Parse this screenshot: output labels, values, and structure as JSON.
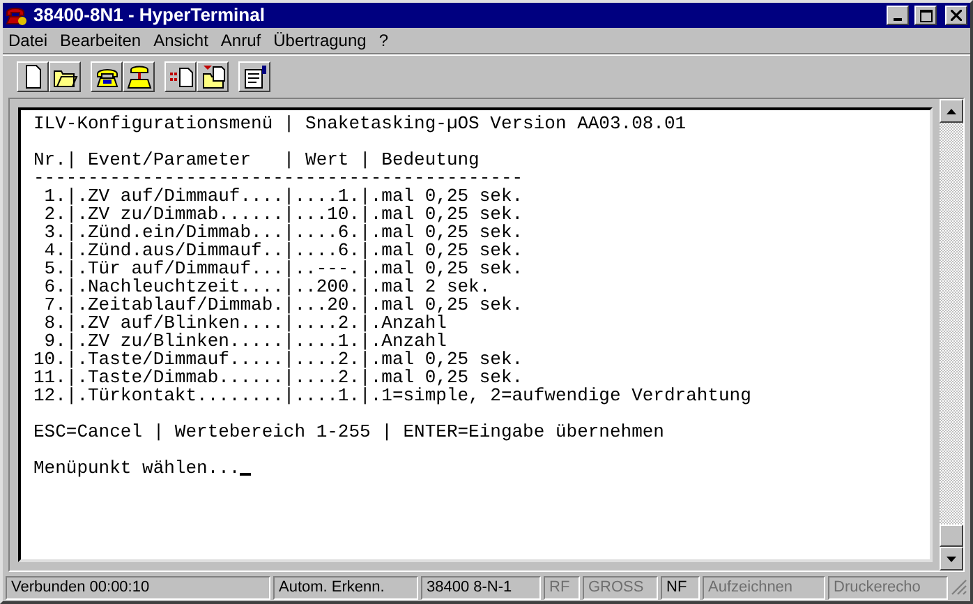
{
  "window": {
    "title": "38400-8N1 - HyperTerminal"
  },
  "menu": [
    "Datei",
    "Bearbeiten",
    "Ansicht",
    "Anruf",
    "Übertragung",
    "?"
  ],
  "toolbar": [
    {
      "kind": "new"
    },
    {
      "kind": "open"
    },
    {
      "kind": "call"
    },
    {
      "kind": "hangup"
    },
    {
      "kind": "send"
    },
    {
      "kind": "receive"
    },
    {
      "kind": "properties"
    }
  ],
  "terminal": {
    "blocks": [
      {
        "lines": [
          "ILV-Konfigurationsmenü | Snaketasking-µOS Version AA03.08.01"
        ]
      },
      {
        "lines": [
          "Nr.| Event/Parameter   | Wert | Bedeutung",
          "---------------------------------------------",
          " 1.|.ZV auf/Dimmauf....|....1.|.mal 0,25 sek.",
          " 2.|.ZV zu/Dimmab......|...10.|.mal 0,25 sek.",
          " 3.|.Zünd.ein/Dimmab...|....6.|.mal 0,25 sek.",
          " 4.|.Zünd.aus/Dimmauf..|....6.|.mal 0,25 sek.",
          " 5.|.Tür auf/Dimmauf...|..---.|.mal 0,25 sek.",
          " 6.|.Nachleuchtzeit....|..200.|.mal 2 sek.",
          " 7.|.Zeitablauf/Dimmab.|...20.|.mal 0,25 sek.",
          " 8.|.ZV auf/Blinken....|....2.|.Anzahl",
          " 9.|.ZV zu/Blinken.....|....1.|.Anzahl",
          "10.|.Taste/Dimmauf.....|....2.|.mal 0,25 sek.",
          "11.|.Taste/Dimmab......|....2.|.mal 0,25 sek.",
          "12.|.Türkontakt........|....1.|.1=simple, 2=aufwendige Verdrahtung"
        ]
      },
      {
        "lines": [
          "ESC=Cancel | Wertebereich 1-255 | ENTER=Eingabe übernehmen"
        ]
      }
    ],
    "prompt": "Menüpunkt wählen...",
    "cursor": true
  },
  "status_bar": [
    {
      "text": "Verbunden 00:00:10",
      "disabled": false
    },
    {
      "text": "Autom. Erkenn.",
      "disabled": false
    },
    {
      "text": "38400 8-N-1",
      "disabled": false
    },
    {
      "text": "RF",
      "disabled": true
    },
    {
      "text": "GROSS",
      "disabled": true
    },
    {
      "text": "NF",
      "disabled": false
    },
    {
      "text": "Aufzeichnen",
      "disabled": true
    },
    {
      "text": "Druckerecho",
      "disabled": true
    }
  ]
}
